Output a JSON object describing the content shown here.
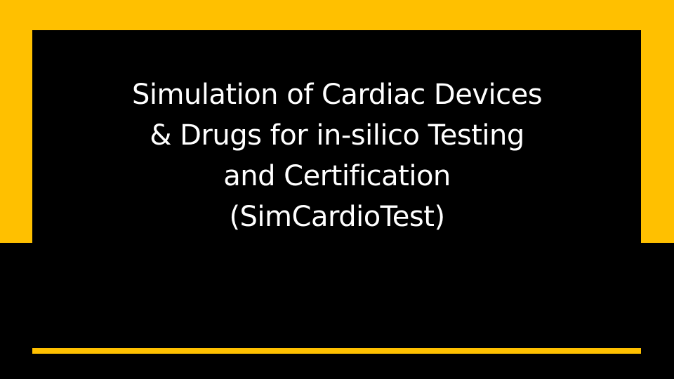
{
  "slide": {
    "title_lines": [
      "Simulation of Cardiac Devices",
      "& Drugs for in-silico Testing",
      "and Certification",
      "(SimCardioTest)"
    ]
  },
  "colors": {
    "accent": "#FFC000",
    "background": "#000000",
    "title_text": "#FFFFFF"
  }
}
